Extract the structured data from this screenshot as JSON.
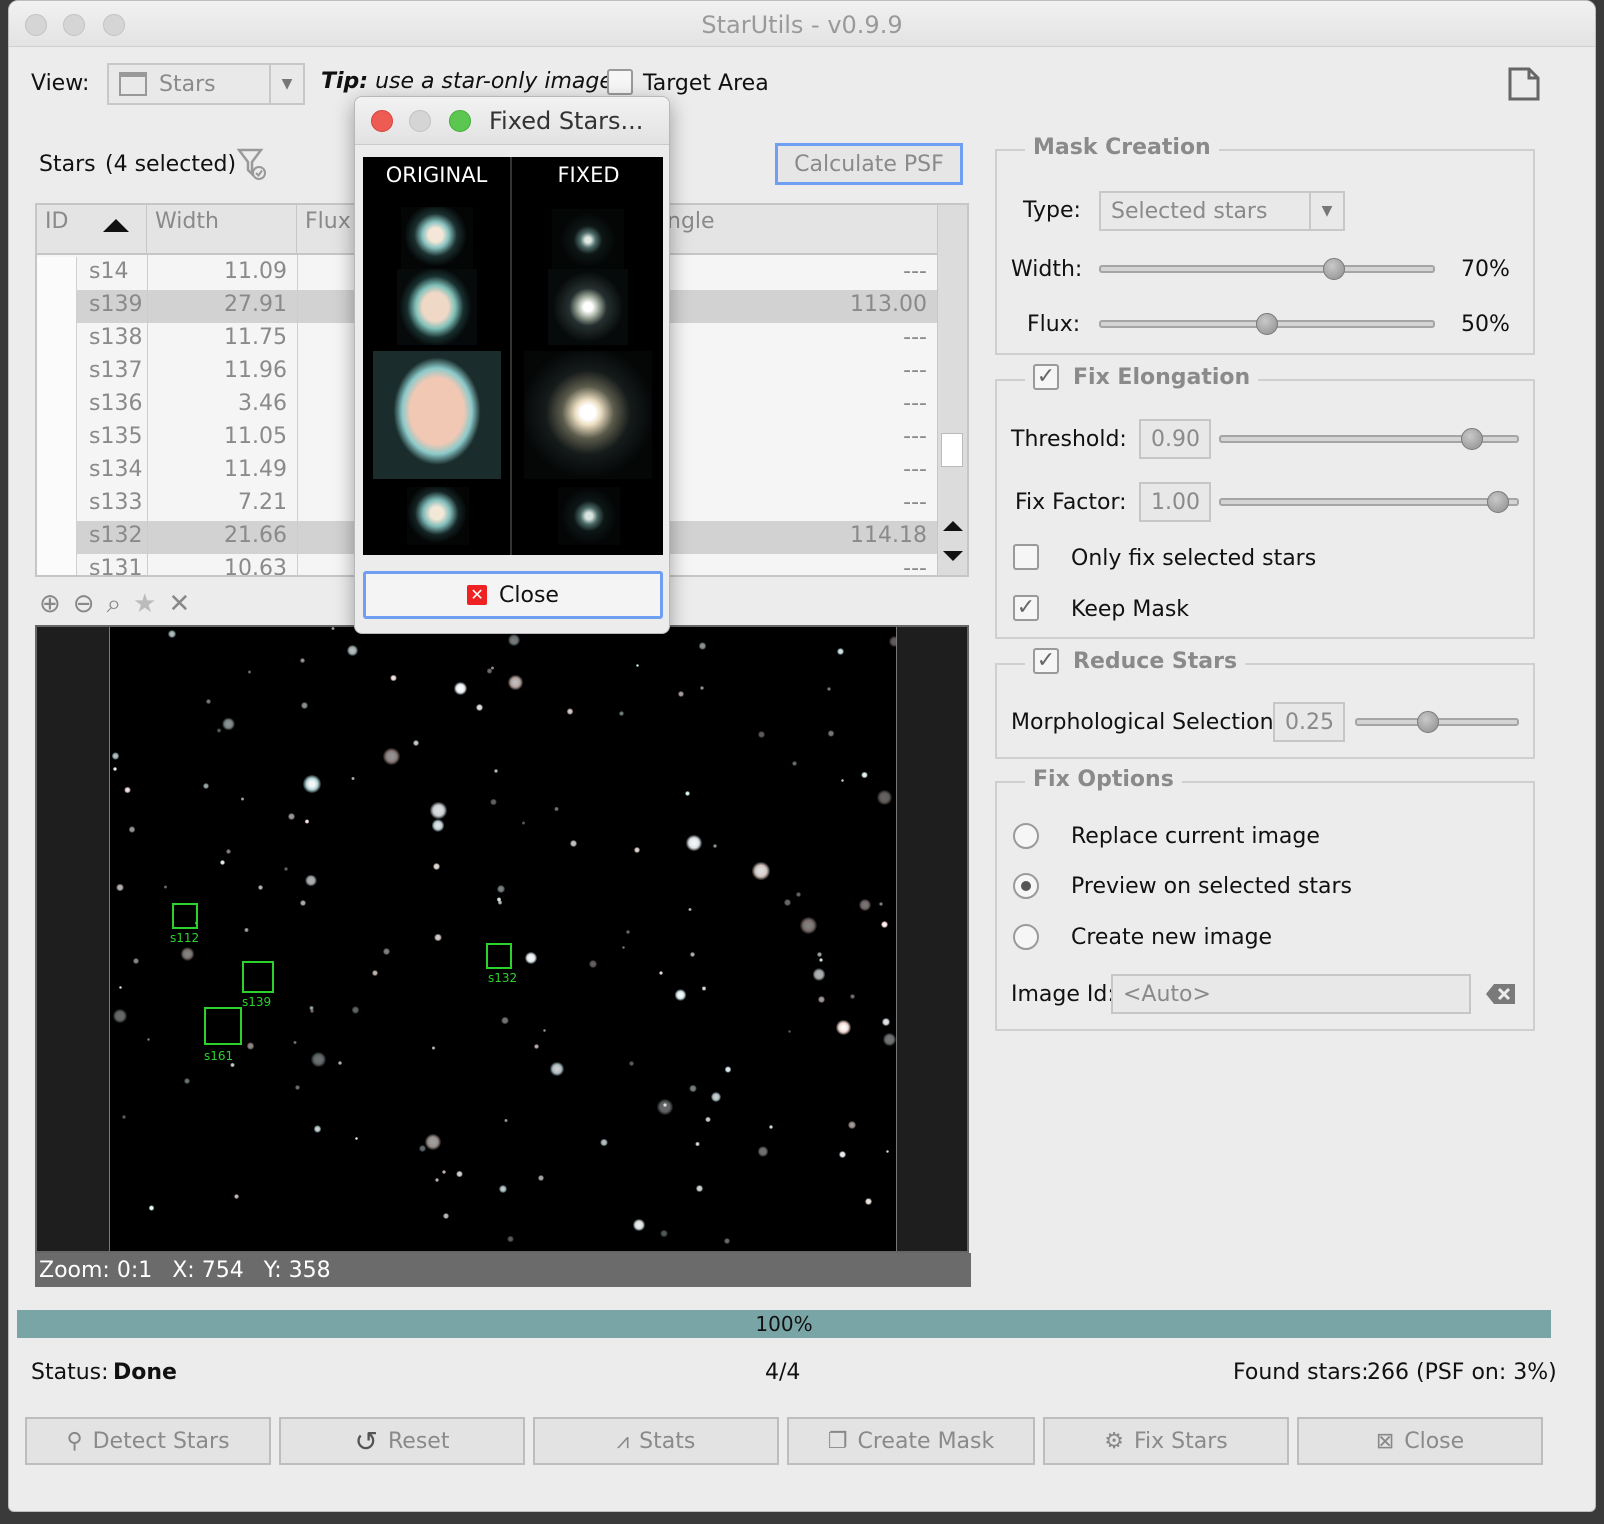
{
  "window": {
    "title": "StarUtils - v0.9.9"
  },
  "toolbar": {
    "view_label": "View:",
    "view_value": "Stars",
    "tip_bold": "Tip:",
    "tip_text": "use a star-only image",
    "target_area_label": "Target Area"
  },
  "stars": {
    "header_label": "Stars",
    "selected_text": "(4 selected)",
    "calculate_psf": "Calculate PSF",
    "columns": [
      "ID",
      "Width",
      "Flux",
      "ngle"
    ],
    "rows": [
      {
        "id": "s14",
        "width": "11.09",
        "angle": "---",
        "selected": false
      },
      {
        "id": "s139",
        "width": "27.91",
        "angle": "113.00",
        "selected": true
      },
      {
        "id": "s138",
        "width": "11.75",
        "angle": "---",
        "selected": false
      },
      {
        "id": "s137",
        "width": "11.96",
        "angle": "---",
        "selected": false
      },
      {
        "id": "s136",
        "width": "3.46",
        "angle": "---",
        "selected": false
      },
      {
        "id": "s135",
        "width": "11.05",
        "angle": "---",
        "selected": false
      },
      {
        "id": "s134",
        "width": "11.49",
        "angle": "---",
        "selected": false
      },
      {
        "id": "s133",
        "width": "7.21",
        "angle": "---",
        "selected": false
      },
      {
        "id": "s132",
        "width": "21.66",
        "angle": "114.18",
        "selected": true
      },
      {
        "id": "s131",
        "width": "10.63",
        "angle": "---",
        "selected": false
      }
    ]
  },
  "viewer": {
    "zoom_text": "Zoom: 0:1",
    "x_text": "X: 754",
    "y_text": "Y: 358",
    "labels": [
      "s112",
      "s139",
      "s161",
      "s132"
    ]
  },
  "mask": {
    "title": "Mask Creation",
    "type_label": "Type:",
    "type_value": "Selected stars",
    "width_label": "Width:",
    "width_value": "70%",
    "width_level": 0.7,
    "flux_label": "Flux:",
    "flux_value": "50%",
    "flux_level": 0.5
  },
  "elongation": {
    "title": "Fix Elongation",
    "checked": true,
    "threshold_label": "Threshold:",
    "threshold_value": "0.90",
    "fix_factor_label": "Fix Factor:",
    "fix_factor_value": "1.00",
    "only_selected_label": "Only fix selected stars",
    "keep_mask_label": "Keep Mask"
  },
  "reduce": {
    "title": "Reduce Stars",
    "checked": true,
    "morph_label": "Morphological Selection:",
    "morph_value": "0.25"
  },
  "fix_options": {
    "title": "Fix Options",
    "replace_label": "Replace current image",
    "preview_label": "Preview on selected stars",
    "create_label": "Create new image",
    "image_id_label": "Image Id:",
    "image_id_placeholder": "<Auto>"
  },
  "progress": {
    "text": "100%",
    "level": 1.0
  },
  "status": {
    "label": "Status:",
    "value": "Done",
    "count": "4/4",
    "found_label": "Found stars:",
    "found_value": "266 (PSF on: 3%)"
  },
  "buttons": {
    "detect": "Detect Stars",
    "reset": "Reset",
    "stats": "Stats",
    "create_mask": "Create Mask",
    "fix": "Fix Stars",
    "close": "Close"
  },
  "dialog": {
    "title": "Fixed Stars...",
    "original": "ORIGINAL",
    "fixed": "FIXED",
    "close": "Close"
  },
  "colors": {
    "progress": "#7aa5a6",
    "focus": "#6f9ef2",
    "selection_box": "#2bd22b"
  }
}
